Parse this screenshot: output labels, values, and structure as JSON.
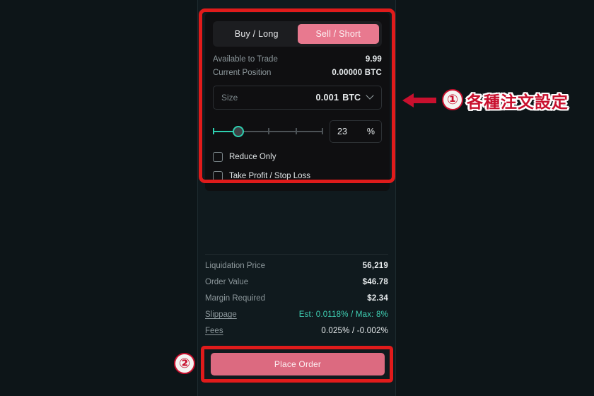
{
  "panel": {
    "side_toggle": {
      "buy_label": "Buy / Long",
      "sell_label": "Sell / Short",
      "active": "sell",
      "active_color": "#e8798f"
    },
    "account_info": [
      {
        "label": "Available to Trade",
        "value": "9.99"
      },
      {
        "label": "Current Position",
        "value": "0.00000 BTC"
      }
    ],
    "size_field": {
      "placeholder": "Size",
      "value": "0.001",
      "unit": "BTC",
      "chevron": "chevron-down-icon"
    },
    "slider": {
      "percent_value": "23",
      "percent_symbol": "%",
      "fill_percent": 23,
      "fill_color": "#2ecfb0",
      "track_color": "#4c5256",
      "ticks": [
        0,
        25,
        50,
        75,
        100
      ]
    },
    "checkboxes": [
      {
        "label": "Reduce Only",
        "checked": false
      },
      {
        "label": "Take Profit / Stop Loss",
        "checked": false
      }
    ],
    "summary": [
      {
        "label": "Liquidation Price",
        "value": "56,219",
        "link": false,
        "accent": false
      },
      {
        "label": "Order Value",
        "value": "$46.78",
        "link": false,
        "accent": false
      },
      {
        "label": "Margin Required",
        "value": "$2.34",
        "link": false,
        "accent": false
      },
      {
        "label": "Slippage",
        "value": "Est: 0.0118% / Max: 8%",
        "link": true,
        "accent": true
      },
      {
        "label": "Fees",
        "value": "0.025% / -0.002%",
        "link": true,
        "accent": false
      }
    ],
    "place_order_label": "Place Order",
    "place_order_color": "#dc6a80",
    "accent_teal": "#3fd0b4"
  },
  "annotations": {
    "marker_1": "①",
    "marker_2": "②",
    "label_1": "各種注文設定",
    "box_color": "#e01b1b",
    "marker_color": "#c8102e"
  }
}
